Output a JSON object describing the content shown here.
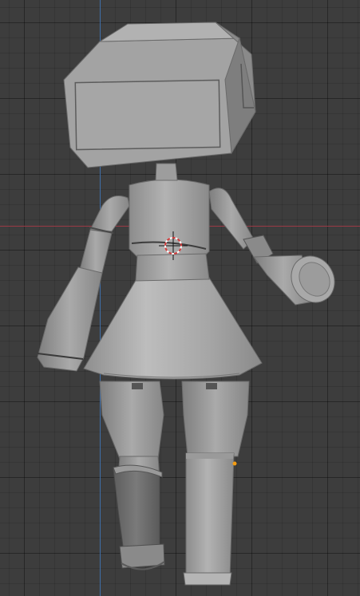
{
  "viewport": {
    "background": "#3d3d3d",
    "axis_colors": {
      "x_axis": "#9b3a45",
      "y_axis": "#3f6ea8"
    },
    "model_color": "#a6a6a6",
    "origin_point_color": "#f39c12",
    "cursor_icon": "3d-cursor"
  }
}
